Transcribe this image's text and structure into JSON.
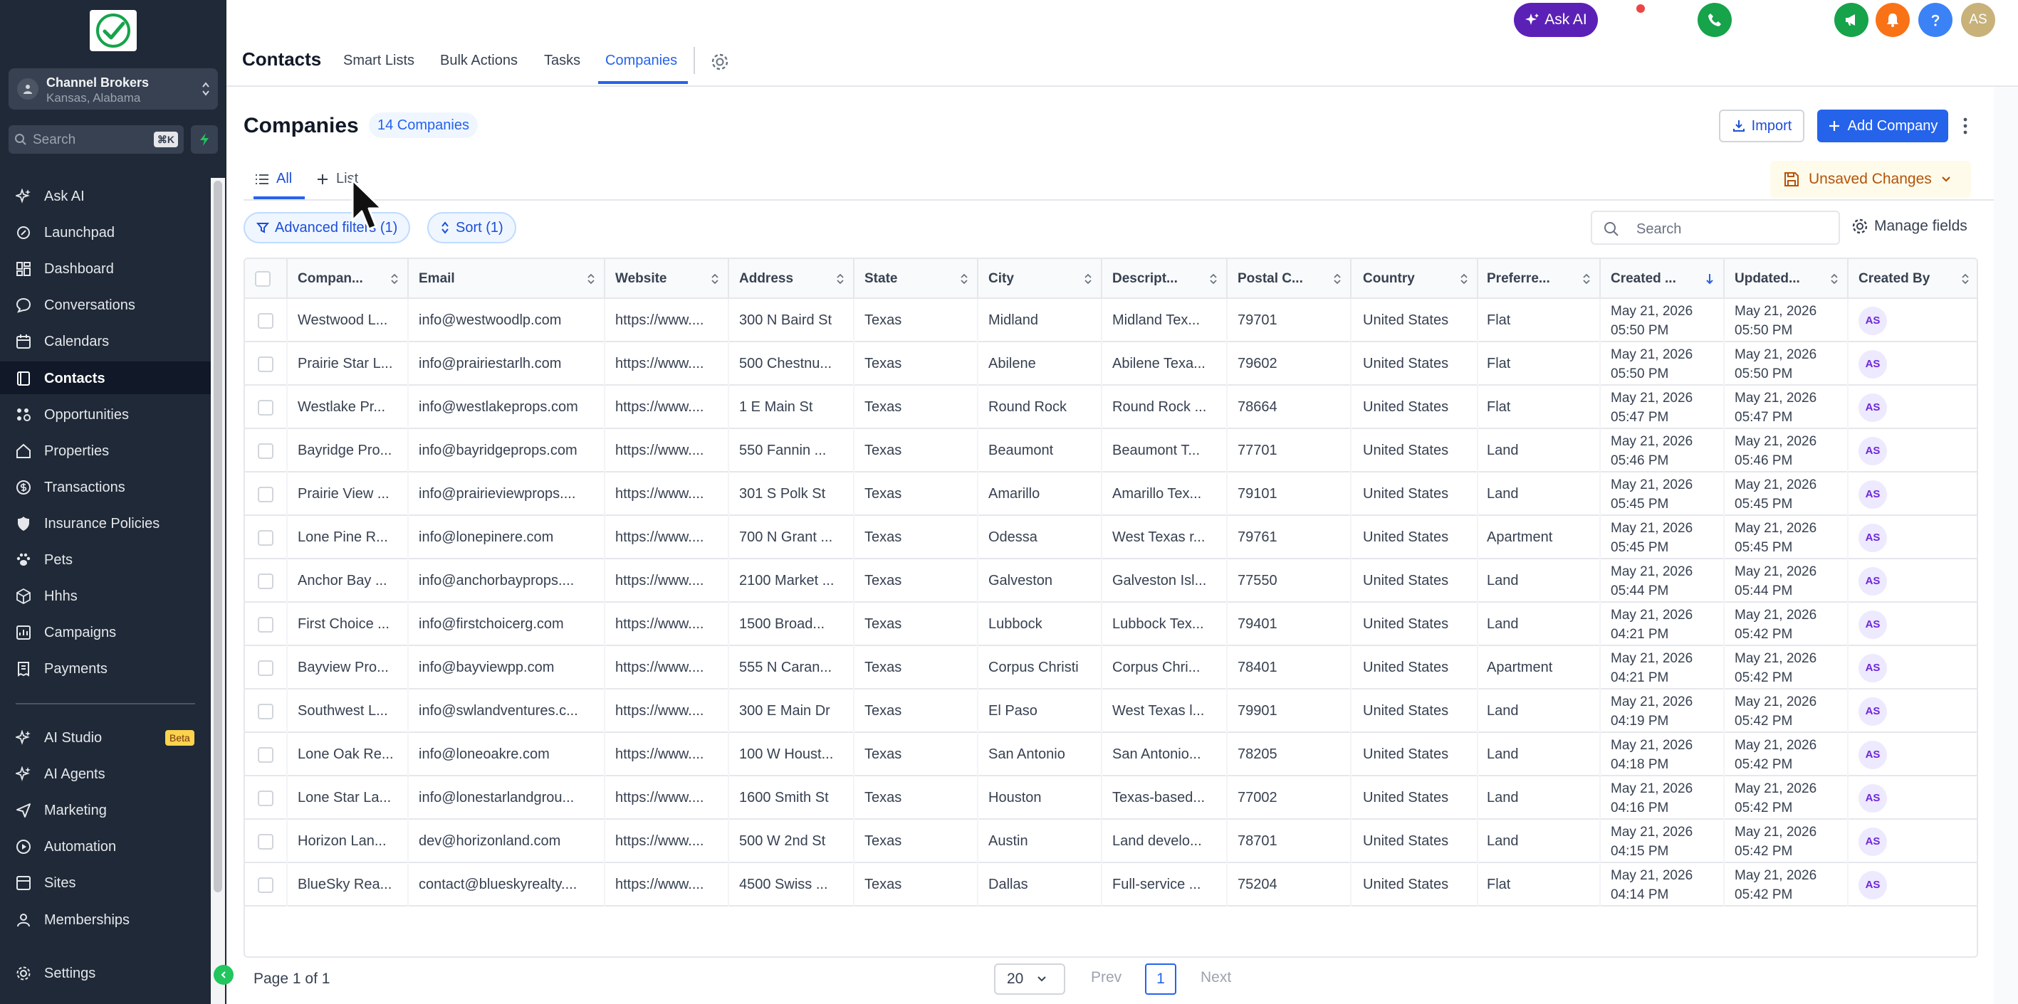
{
  "sidebar": {
    "account": {
      "name": "Channel Brokers",
      "location": "Kansas, Alabama"
    },
    "search": {
      "placeholder": "Search",
      "shortcut": "⌘K"
    },
    "items": [
      {
        "label": "Ask AI",
        "icon": "sparkle-icon"
      },
      {
        "label": "Launchpad",
        "icon": "rocket-icon"
      },
      {
        "label": "Dashboard",
        "icon": "dashboard-icon"
      },
      {
        "label": "Conversations",
        "icon": "chat-icon"
      },
      {
        "label": "Calendars",
        "icon": "calendar-icon"
      },
      {
        "label": "Contacts",
        "icon": "contacts-icon",
        "active": true
      },
      {
        "label": "Opportunities",
        "icon": "opportunities-icon"
      },
      {
        "label": "Properties",
        "icon": "house-icon"
      },
      {
        "label": "Transactions",
        "icon": "dollar-icon"
      },
      {
        "label": "Insurance Policies",
        "icon": "shield-icon"
      },
      {
        "label": "Pets",
        "icon": "paw-icon"
      },
      {
        "label": "Hhhs",
        "icon": "cube-icon"
      },
      {
        "label": "Campaigns",
        "icon": "campaign-icon"
      },
      {
        "label": "Payments",
        "icon": "receipt-icon"
      }
    ],
    "items2": [
      {
        "label": "AI Studio",
        "icon": "sparkle-icon",
        "badge": "Beta"
      },
      {
        "label": "AI Agents",
        "icon": "sparkle-icon"
      },
      {
        "label": "Marketing",
        "icon": "send-icon"
      },
      {
        "label": "Automation",
        "icon": "automation-icon"
      },
      {
        "label": "Sites",
        "icon": "globe-icon"
      },
      {
        "label": "Memberships",
        "icon": "membership-icon"
      }
    ],
    "settings": "Settings"
  },
  "topbar": {
    "title": "Contacts",
    "tabs": [
      "Smart Lists",
      "Bulk Actions",
      "Tasks",
      "Companies"
    ],
    "active_tab": "Companies",
    "ask_ai": "Ask AI",
    "user_initials": "AS"
  },
  "main": {
    "title": "Companies",
    "count": "14 Companies",
    "import": "Import",
    "add": "Add Company",
    "view_tabs": [
      "All",
      "List"
    ],
    "unsaved": "Unsaved Changes",
    "filter_chip": "Advanced filters (1)",
    "sort_chip": "Sort (1)",
    "search_placeholder": "Search",
    "manage_fields": "Manage fields"
  },
  "table": {
    "columns": [
      "Compan...",
      "Email",
      "Website",
      "Address",
      "State",
      "City",
      "Descript...",
      "Postal C...",
      "Country",
      "Preferre...",
      "Created ...",
      "Updated...",
      "Created By"
    ],
    "rows": [
      {
        "c": [
          "Westwood L...",
          "info@westwoodlp.com",
          "https://www....",
          "300 N Baird St",
          "Texas",
          "Midland",
          "Midland Tex...",
          "79701",
          "United States",
          "Flat"
        ],
        "cd": "May 21, 2026",
        "ct": "05:50 PM",
        "ud": "May 21, 2026",
        "ut": "05:50 PM",
        "by": "AS"
      },
      {
        "c": [
          "Prairie Star L...",
          "info@prairiestarlh.com",
          "https://www....",
          "500 Chestnu...",
          "Texas",
          "Abilene",
          "Abilene Texa...",
          "79602",
          "United States",
          "Flat"
        ],
        "cd": "May 21, 2026",
        "ct": "05:50 PM",
        "ud": "May 21, 2026",
        "ut": "05:50 PM",
        "by": "AS"
      },
      {
        "c": [
          "Westlake Pr...",
          "info@westlakeprops.com",
          "https://www....",
          "1 E Main St",
          "Texas",
          "Round Rock",
          "Round Rock ...",
          "78664",
          "United States",
          "Flat"
        ],
        "cd": "May 21, 2026",
        "ct": "05:47 PM",
        "ud": "May 21, 2026",
        "ut": "05:47 PM",
        "by": "AS"
      },
      {
        "c": [
          "Bayridge Pro...",
          "info@bayridgeprops.com",
          "https://www....",
          "550 Fannin ...",
          "Texas",
          "Beaumont",
          "Beaumont T...",
          "77701",
          "United States",
          "Land"
        ],
        "cd": "May 21, 2026",
        "ct": "05:46 PM",
        "ud": "May 21, 2026",
        "ut": "05:46 PM",
        "by": "AS"
      },
      {
        "c": [
          "Prairie View ...",
          "info@prairieviewprops....",
          "https://www....",
          "301 S Polk St",
          "Texas",
          "Amarillo",
          "Amarillo Tex...",
          "79101",
          "United States",
          "Land"
        ],
        "cd": "May 21, 2026",
        "ct": "05:45 PM",
        "ud": "May 21, 2026",
        "ut": "05:45 PM",
        "by": "AS"
      },
      {
        "c": [
          "Lone Pine R...",
          "info@lonepinere.com",
          "https://www....",
          "700 N Grant ...",
          "Texas",
          "Odessa",
          "West Texas r...",
          "79761",
          "United States",
          "Apartment"
        ],
        "cd": "May 21, 2026",
        "ct": "05:45 PM",
        "ud": "May 21, 2026",
        "ut": "05:45 PM",
        "by": "AS"
      },
      {
        "c": [
          "Anchor Bay ...",
          "info@anchorbayprops....",
          "https://www....",
          "2100 Market ...",
          "Texas",
          "Galveston",
          "Galveston Isl...",
          "77550",
          "United States",
          "Land"
        ],
        "cd": "May 21, 2026",
        "ct": "05:44 PM",
        "ud": "May 21, 2026",
        "ut": "05:44 PM",
        "by": "AS"
      },
      {
        "c": [
          "First Choice ...",
          "info@firstchoicerg.com",
          "https://www....",
          "1500 Broad...",
          "Texas",
          "Lubbock",
          "Lubbock Tex...",
          "79401",
          "United States",
          "Land"
        ],
        "cd": "May 21, 2026",
        "ct": "04:21 PM",
        "ud": "May 21, 2026",
        "ut": "05:42 PM",
        "by": "AS"
      },
      {
        "c": [
          "Bayview Pro...",
          "info@bayviewpp.com",
          "https://www....",
          "555 N Caran...",
          "Texas",
          "Corpus Christi",
          "Corpus Chri...",
          "78401",
          "United States",
          "Apartment"
        ],
        "cd": "May 21, 2026",
        "ct": "04:21 PM",
        "ud": "May 21, 2026",
        "ut": "05:42 PM",
        "by": "AS"
      },
      {
        "c": [
          "Southwest L...",
          "info@swlandventures.c...",
          "https://www....",
          "300 E Main Dr",
          "Texas",
          "El Paso",
          "West Texas l...",
          "79901",
          "United States",
          "Land"
        ],
        "cd": "May 21, 2026",
        "ct": "04:19 PM",
        "ud": "May 21, 2026",
        "ut": "05:42 PM",
        "by": "AS"
      },
      {
        "c": [
          "Lone Oak Re...",
          "info@loneoakre.com",
          "https://www....",
          "100 W Houst...",
          "Texas",
          "San Antonio",
          "San Antonio...",
          "78205",
          "United States",
          "Land"
        ],
        "cd": "May 21, 2026",
        "ct": "04:18 PM",
        "ud": "May 21, 2026",
        "ut": "05:42 PM",
        "by": "AS"
      },
      {
        "c": [
          "Lone Star La...",
          "info@lonestarlandgrou...",
          "https://www....",
          "1600 Smith St",
          "Texas",
          "Houston",
          "Texas-based...",
          "77002",
          "United States",
          "Land"
        ],
        "cd": "May 21, 2026",
        "ct": "04:16 PM",
        "ud": "May 21, 2026",
        "ut": "05:42 PM",
        "by": "AS"
      },
      {
        "c": [
          "Horizon Lan...",
          "dev@horizonland.com",
          "https://www....",
          "500 W 2nd St",
          "Texas",
          "Austin",
          "Land develo...",
          "78701",
          "United States",
          "Land"
        ],
        "cd": "May 21, 2026",
        "ct": "04:15 PM",
        "ud": "May 21, 2026",
        "ut": "05:42 PM",
        "by": "AS"
      },
      {
        "c": [
          "BlueSky Rea...",
          "contact@blueskyrealty....",
          "https://www....",
          "4500 Swiss ...",
          "Texas",
          "Dallas",
          "Full-service ...",
          "75204",
          "United States",
          "Flat"
        ],
        "cd": "May 21, 2026",
        "ct": "04:14 PM",
        "ud": "May 21, 2026",
        "ut": "05:42 PM",
        "by": "AS"
      }
    ]
  },
  "pagination": {
    "info": "Page 1 of 1",
    "page_size": "20",
    "prev": "Prev",
    "page": "1",
    "next": "Next"
  },
  "colors": {
    "accent": "#2563eb",
    "sidebar": "#1f2937",
    "warning": "#b45309"
  }
}
